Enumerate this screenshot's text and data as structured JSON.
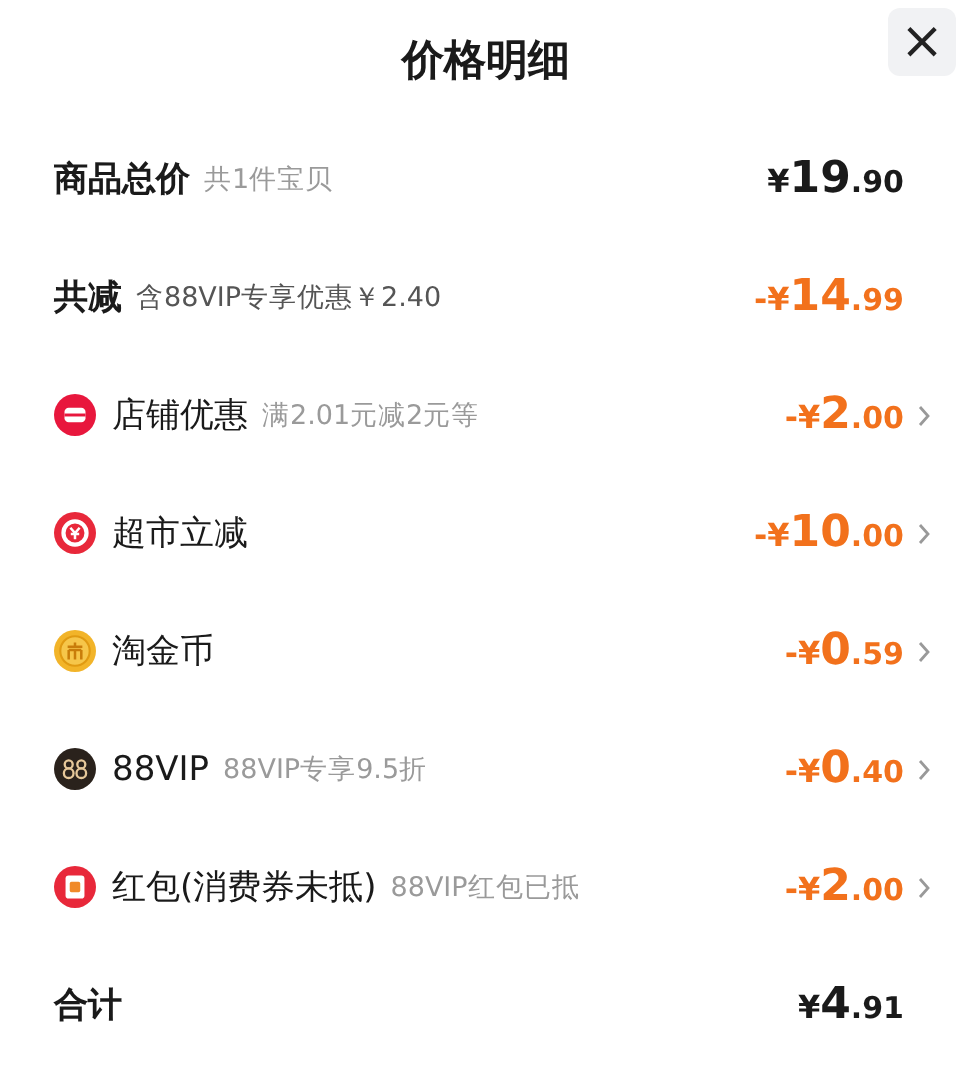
{
  "header": {
    "title": "价格明细",
    "close": "×"
  },
  "rows": [
    {
      "kind": "summary",
      "label": "商品总价",
      "note": "共1件宝贝",
      "price": "¥19.90"
    },
    {
      "kind": "discount_total",
      "label": "共减",
      "note": "含88VIP专享优惠￥2.40",
      "price": "-¥14.99"
    },
    {
      "kind": "item",
      "label": "店铺优惠",
      "note": "满2.01元减2元等",
      "price": "-¥2.00"
    },
    {
      "kind": "item",
      "label": "超市立减",
      "price": "-¥10.00"
    },
    {
      "kind": "item",
      "label": "淘金币",
      "price": "-¥0.59"
    },
    {
      "kind": "item",
      "label": "88VIP",
      "note": "88VIP专享9.5折",
      "price": "-¥0.40"
    },
    {
      "kind": "item",
      "label": "红包(消费券未抵)",
      "note": "88VIP红包已抵",
      "price": "-¥2.00"
    },
    {
      "kind": "summary",
      "label": "合计",
      "price": "¥4.91"
    }
  ]
}
